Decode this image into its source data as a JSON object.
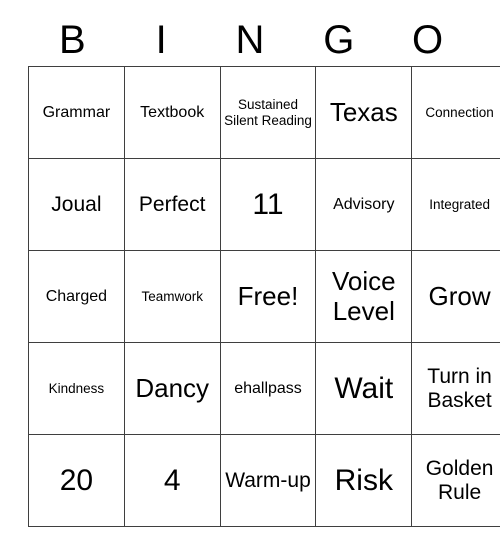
{
  "card": {
    "header_letters": [
      "B",
      "I",
      "N",
      "G",
      "O"
    ],
    "rows": [
      [
        {
          "text": "Grammar",
          "size": "sz-s"
        },
        {
          "text": "Textbook",
          "size": "sz-s"
        },
        {
          "text": "Sustained Silent Reading",
          "size": "sz-xs"
        },
        {
          "text": "Texas",
          "size": "sz-l"
        },
        {
          "text": "Connection",
          "size": "sz-xs"
        }
      ],
      [
        {
          "text": "Joual",
          "size": "sz-m"
        },
        {
          "text": "Perfect",
          "size": "sz-m"
        },
        {
          "text": "11",
          "size": "sz-xl"
        },
        {
          "text": "Advisory",
          "size": "sz-s"
        },
        {
          "text": "Integrated",
          "size": "sz-xs"
        }
      ],
      [
        {
          "text": "Charged",
          "size": "sz-s"
        },
        {
          "text": "Teamwork",
          "size": "sz-xs"
        },
        {
          "text": "Free!",
          "size": "sz-l"
        },
        {
          "text": "Voice Level",
          "size": "sz-l"
        },
        {
          "text": "Grow",
          "size": "sz-l"
        }
      ],
      [
        {
          "text": "Kindness",
          "size": "sz-xs"
        },
        {
          "text": "Dancy",
          "size": "sz-l"
        },
        {
          "text": "ehallpass",
          "size": "sz-s"
        },
        {
          "text": "Wait",
          "size": "sz-xl"
        },
        {
          "text": "Turn in Basket",
          "size": "sz-m"
        }
      ],
      [
        {
          "text": "20",
          "size": "sz-xl"
        },
        {
          "text": "4",
          "size": "sz-xl"
        },
        {
          "text": "Warm-up",
          "size": "sz-m"
        },
        {
          "text": "Risk",
          "size": "sz-xl"
        },
        {
          "text": "Golden Rule",
          "size": "sz-m"
        }
      ]
    ]
  }
}
